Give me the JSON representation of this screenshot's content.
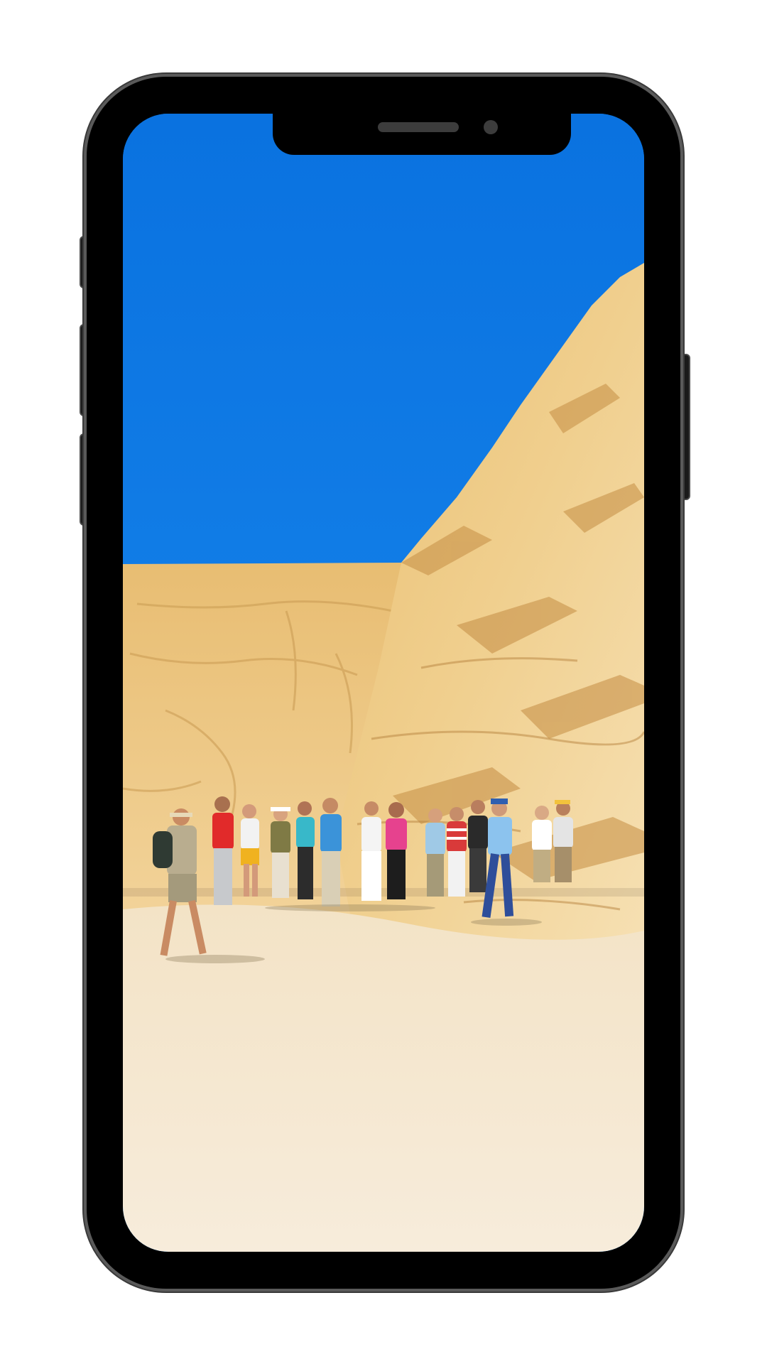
{
  "device": {
    "type": "smartphone",
    "frame_color": "#000000",
    "frame_outline_color": "#5a5a5a",
    "buttons": [
      "mute-switch",
      "volume-up",
      "volume-down",
      "power"
    ]
  },
  "screen": {
    "content": "photo",
    "palette": {
      "sky": "#0c7be6",
      "rock_light": "#f2d59a",
      "rock_mid": "#e3b96e",
      "rock_shadow": "#c9974f",
      "ground": "#f1e2c8"
    }
  }
}
